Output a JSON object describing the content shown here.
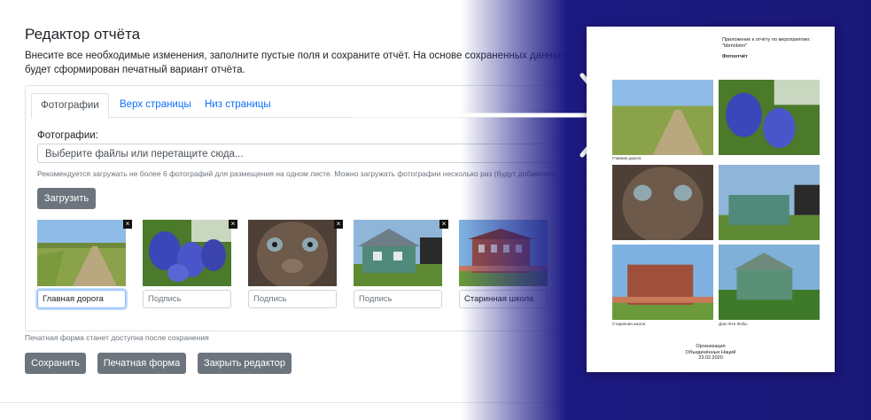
{
  "editor": {
    "title": "Редактор отчёта",
    "intro": "Внесите все необходимые изменения, заполните пустые поля и сохраните отчёт. На основе сохраненных данных будет сформирован печатный вариант отчёта.",
    "tabs": [
      {
        "label": "Фотографии",
        "active": true
      },
      {
        "label": "Верх страницы",
        "active": false
      },
      {
        "label": "Низ страницы",
        "active": false
      }
    ],
    "photos_label": "Фотографии:",
    "file_placeholder": "Выберите файлы или перетащите сюда...",
    "hint": "Рекомендуется загружать не более 6 фотографий для размещения на одном листе. Можно загружать фотографии несколько раз (будут добавлены к уже загруженным).",
    "upload_button": "Загрузить",
    "remove_icon": "×",
    "caption_placeholder": "Подпись",
    "photos": [
      {
        "icon": "road-photo",
        "caption": "Главная дорога"
      },
      {
        "icon": "flowers-photo",
        "caption": ""
      },
      {
        "icon": "cat-photo",
        "caption": ""
      },
      {
        "icon": "house-photo",
        "caption": ""
      },
      {
        "icon": "school-photo",
        "caption": "Старинная школа"
      }
    ],
    "print_note": "Печатная форма станет доступна после сохранения",
    "buttons": {
      "save": "Сохранить",
      "print": "Печатная форма",
      "close": "Закрыть редактор"
    }
  },
  "document": {
    "header": "Приложение к отчёту по мероприятию: \"bbmnbmn\"",
    "title": "Фотоотчёт",
    "captions": [
      "Главная дорога",
      "",
      "",
      "",
      "Старинная школа",
      "Дом тёти Любы"
    ],
    "footer_org": "Организация",
    "footer_name": "Объединённых Наций",
    "footer_date": "23.02.2020"
  },
  "colors": {
    "button": "#6c757d",
    "link": "#0d6efd",
    "navy": "#1a1877"
  }
}
